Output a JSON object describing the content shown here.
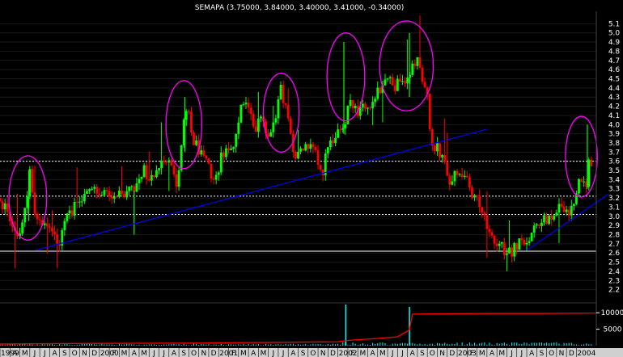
{
  "chart_data": {
    "type": "candlestick",
    "title": "SEMAPA (3.75000, 3.84000, 3.40000, 3.41000, -0.34000)",
    "ylim": [
      2.1,
      5.2
    ],
    "y_ticks": [
      "5.1",
      "5.0",
      "4.9",
      "4.8",
      "4.7",
      "4.6",
      "4.5",
      "4.4",
      "4.3",
      "4.2",
      "4.1",
      "4.0",
      "3.9",
      "3.8",
      "3.7",
      "3.6",
      "3.5",
      "3.4",
      "3.3",
      "3.2",
      "3.1",
      "3.0",
      "2.9",
      "2.8",
      "2.7",
      "2.6",
      "2.5",
      "2.4",
      "2.3",
      "2.2"
    ],
    "y_values": [
      5.1,
      5.0,
      4.9,
      4.8,
      4.7,
      4.6,
      4.5,
      4.4,
      4.3,
      4.2,
      4.1,
      4.0,
      3.9,
      3.8,
      3.7,
      3.6,
      3.5,
      3.4,
      3.3,
      3.2,
      3.1,
      3.0,
      2.9,
      2.8,
      2.7,
      2.6,
      2.5,
      2.4,
      2.3,
      2.2
    ],
    "x_ticks": [
      "1999",
      "A",
      "M",
      "J",
      "J",
      "A",
      "S",
      "O",
      "N",
      "D",
      "2000",
      "F",
      "M",
      "A",
      "M",
      "J",
      "J",
      "A",
      "S",
      "O",
      "N",
      "D",
      "2001",
      "F",
      "M",
      "A",
      "M",
      "J",
      "J",
      "A",
      "S",
      "O",
      "N",
      "D",
      "2002",
      "F",
      "M",
      "A",
      "M",
      "J",
      "J",
      "A",
      "S",
      "O",
      "N",
      "D",
      "2003",
      "F",
      "M",
      "A",
      "M",
      "J",
      "J",
      "A",
      "S",
      "O",
      "N",
      "D",
      "2004"
    ],
    "x_range_months": [
      0,
      60
    ],
    "horizontal_levels": [
      {
        "value": 3.6,
        "style": "dashed"
      },
      {
        "value": 3.22,
        "style": "dashed"
      },
      {
        "value": 3.02,
        "style": "dashed"
      },
      {
        "value": 2.62,
        "style": "solid"
      }
    ],
    "trendlines": [
      {
        "from": [
          3.6,
          2.63
        ],
        "to": [
          49.0,
          3.95
        ]
      },
      {
        "from": [
          53.0,
          2.63
        ],
        "to": [
          61.2,
          3.24
        ]
      }
    ],
    "ellipses": [
      {
        "cx": 2.8,
        "cy": 3.2,
        "rx": 1.9,
        "ry": 0.46
      },
      {
        "cx": 18.5,
        "cy": 4.0,
        "rx": 1.8,
        "ry": 0.48
      },
      {
        "cx": 28.3,
        "cy": 4.13,
        "rx": 1.8,
        "ry": 0.43
      },
      {
        "cx": 34.8,
        "cy": 4.52,
        "rx": 1.9,
        "ry": 0.48
      },
      {
        "cx": 40.9,
        "cy": 4.64,
        "rx": 2.7,
        "ry": 0.49
      },
      {
        "cx": 58.5,
        "cy": 3.65,
        "rx": 1.6,
        "ry": 0.44
      }
    ],
    "price_anchors": [
      [
        0,
        3.2
      ],
      [
        0.6,
        3.05
      ],
      [
        1.2,
        2.85
      ],
      [
        1.8,
        2.78
      ],
      [
        2.6,
        3.15
      ],
      [
        3.0,
        3.45
      ],
      [
        3.5,
        3.0
      ],
      [
        4.2,
        2.95
      ],
      [
        5.2,
        2.8
      ],
      [
        5.9,
        2.68
      ],
      [
        6.5,
        2.95
      ],
      [
        7.5,
        3.1
      ],
      [
        8.5,
        3.22
      ],
      [
        9.5,
        3.27
      ],
      [
        10.5,
        3.24
      ],
      [
        11.5,
        3.26
      ],
      [
        12.5,
        3.27
      ],
      [
        13.5,
        3.28
      ],
      [
        14.0,
        3.4
      ],
      [
        14.5,
        3.55
      ],
      [
        15.0,
        3.4
      ],
      [
        15.5,
        3.4
      ],
      [
        16.3,
        3.6
      ],
      [
        17.3,
        3.55
      ],
      [
        17.8,
        3.3
      ],
      [
        18.4,
        3.95
      ],
      [
        18.9,
        4.15
      ],
      [
        19.3,
        3.85
      ],
      [
        19.8,
        3.75
      ],
      [
        20.8,
        3.6
      ],
      [
        21.6,
        3.35
      ],
      [
        22.3,
        3.65
      ],
      [
        22.8,
        3.8
      ],
      [
        23.3,
        3.7
      ],
      [
        23.8,
        3.95
      ],
      [
        24.3,
        4.2
      ],
      [
        24.8,
        4.3
      ],
      [
        25.3,
        4.05
      ],
      [
        25.8,
        3.95
      ],
      [
        26.3,
        4.1
      ],
      [
        26.8,
        3.95
      ],
      [
        27.3,
        3.9
      ],
      [
        27.8,
        4.15
      ],
      [
        28.2,
        4.4
      ],
      [
        28.8,
        4.2
      ],
      [
        29.2,
        4.0
      ],
      [
        29.6,
        3.65
      ],
      [
        30.2,
        3.8
      ],
      [
        30.8,
        3.75
      ],
      [
        31.3,
        3.8
      ],
      [
        31.9,
        3.6
      ],
      [
        32.3,
        3.42
      ],
      [
        32.8,
        3.65
      ],
      [
        33.3,
        3.8
      ],
      [
        33.8,
        3.85
      ],
      [
        34.3,
        4.0
      ],
      [
        34.8,
        4.05
      ],
      [
        35.2,
        4.3
      ],
      [
        35.6,
        4.2
      ],
      [
        36.2,
        4.12
      ],
      [
        36.8,
        4.2
      ],
      [
        37.3,
        4.15
      ],
      [
        37.8,
        4.3
      ],
      [
        38.3,
        4.4
      ],
      [
        38.8,
        4.55
      ],
      [
        39.3,
        4.48
      ],
      [
        39.6,
        4.35
      ],
      [
        40.0,
        4.52
      ],
      [
        40.6,
        4.5
      ],
      [
        41.2,
        4.55
      ],
      [
        41.7,
        4.7
      ],
      [
        42.2,
        4.65
      ],
      [
        42.6,
        4.45
      ],
      [
        43.0,
        4.3
      ],
      [
        43.2,
        3.95
      ],
      [
        43.6,
        3.8
      ],
      [
        44.2,
        3.7
      ],
      [
        44.8,
        3.52
      ],
      [
        45.3,
        3.3
      ],
      [
        45.8,
        3.45
      ],
      [
        46.3,
        3.45
      ],
      [
        46.8,
        3.4
      ],
      [
        47.3,
        3.3
      ],
      [
        47.8,
        3.2
      ],
      [
        48.3,
        3.1
      ],
      [
        48.8,
        2.95
      ],
      [
        49.3,
        2.85
      ],
      [
        49.8,
        2.75
      ],
      [
        50.3,
        2.7
      ],
      [
        50.8,
        2.62
      ],
      [
        51.3,
        2.6
      ],
      [
        51.8,
        2.65
      ],
      [
        52.3,
        2.7
      ],
      [
        52.8,
        2.72
      ],
      [
        53.3,
        2.8
      ],
      [
        53.8,
        2.85
      ],
      [
        54.3,
        2.92
      ],
      [
        54.8,
        2.95
      ],
      [
        55.3,
        3.0
      ],
      [
        55.8,
        3.05
      ],
      [
        56.3,
        3.1
      ],
      [
        56.8,
        3.0
      ],
      [
        57.3,
        3.05
      ],
      [
        57.8,
        3.2
      ],
      [
        58.2,
        3.35
      ],
      [
        58.6,
        3.38
      ],
      [
        59.0,
        3.35
      ],
      [
        59.3,
        3.75
      ],
      [
        59.6,
        3.45
      ]
    ],
    "volume": {
      "scale_labels": [
        "10000",
        "5000"
      ],
      "scale_values": [
        10000,
        5000
      ],
      "avg_line": [
        [
          0,
          500
        ],
        [
          10,
          700
        ],
        [
          20,
          800
        ],
        [
          34,
          1200
        ],
        [
          35,
          1600
        ],
        [
          36,
          1800
        ],
        [
          38,
          2200
        ],
        [
          40,
          2700
        ],
        [
          41.2,
          4800
        ],
        [
          41.5,
          9600
        ],
        [
          45,
          9700
        ],
        [
          50,
          9800
        ],
        [
          55,
          9800
        ],
        [
          60,
          9900
        ]
      ],
      "spikes": [
        {
          "x": 34.8,
          "v": 12500
        },
        {
          "x": 41.2,
          "v": 11800
        }
      ]
    },
    "colors": {
      "background": "#000000",
      "up": "#00ff00",
      "down": "#ff0000",
      "trendline": "#0000ff",
      "ellipse": "#ff00ff",
      "level": "#ffffff",
      "volume_line": "#ff0000",
      "volume_bar": "#00ffff",
      "axis_text": "#ffffff"
    }
  }
}
